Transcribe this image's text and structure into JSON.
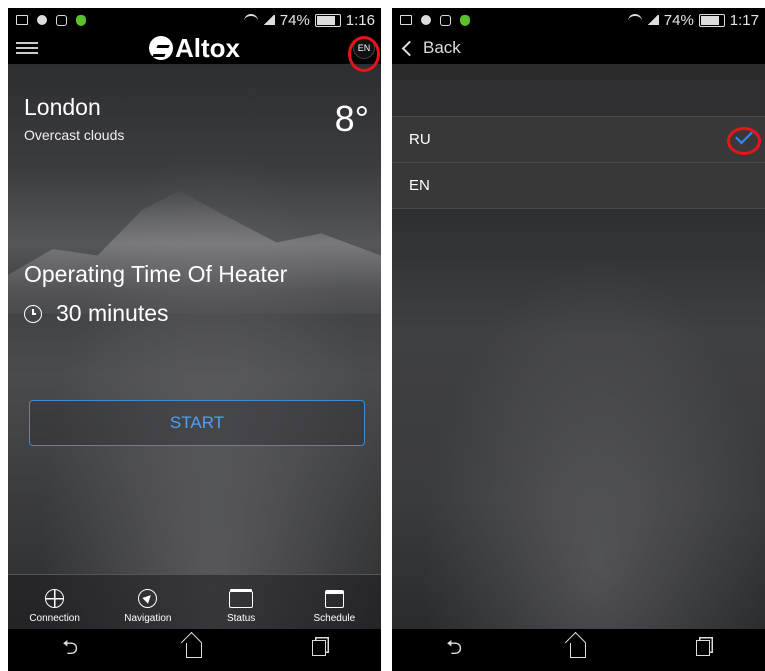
{
  "left_screen": {
    "status": {
      "battery": "74%",
      "time": "1:16"
    },
    "brand": "Altox",
    "language_badge": "EN",
    "weather": {
      "city": "London",
      "condition": "Overcast clouds",
      "temperature": "8°"
    },
    "operating_title": "Operating Time Of Heater",
    "duration": "30 minutes",
    "start_label": "START",
    "tabs": [
      {
        "label": "Connection",
        "icon": "globe-icon"
      },
      {
        "label": "Navigation",
        "icon": "compass-icon"
      },
      {
        "label": "Status",
        "icon": "layers-icon"
      },
      {
        "label": "Schedule",
        "icon": "calendar-icon"
      }
    ]
  },
  "right_screen": {
    "status": {
      "battery": "74%",
      "time": "1:17"
    },
    "back_label": "Back",
    "languages": [
      {
        "code": "RU",
        "selected": true
      },
      {
        "code": "EN",
        "selected": false
      }
    ]
  },
  "colors": {
    "accent": "#2f8cff",
    "highlight_ring": "#e8141a",
    "start_border": "#3f8ad8"
  }
}
